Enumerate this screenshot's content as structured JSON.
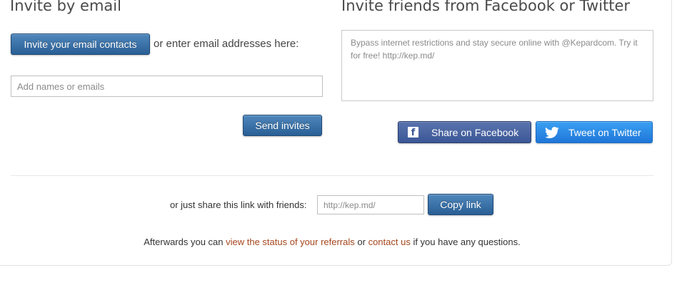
{
  "email_section": {
    "heading": "Invite by email",
    "invite_contacts_label": "Invite your email contacts",
    "or_enter_text": "or enter email addresses here:",
    "emails_placeholder": "Add names or emails",
    "send_invites_label": "Send invites"
  },
  "social_section": {
    "heading": "Invite friends from Facebook or Twitter",
    "share_message": "Bypass internet restrictions and stay secure online with @Kepardcom. Try it for free! http://kep.md/",
    "facebook_label": "Share on Facebook",
    "twitter_label": "Tweet on Twitter"
  },
  "share_link": {
    "prompt": "or just share this link with friends:",
    "url": "http://kep.md/",
    "copy_label": "Copy link"
  },
  "footer": {
    "prefix": "Afterwards you can ",
    "status_link": "view the status of your referrals",
    "middle": " or ",
    "contact_link": "contact us",
    "suffix": " if you have any questions."
  },
  "colors": {
    "primary_button": "#2f6598",
    "facebook": "#3b5796",
    "twitter": "#2a89e6",
    "link": "#a5461c"
  },
  "icons": [
    "facebook-icon",
    "twitter-bird-icon"
  ]
}
